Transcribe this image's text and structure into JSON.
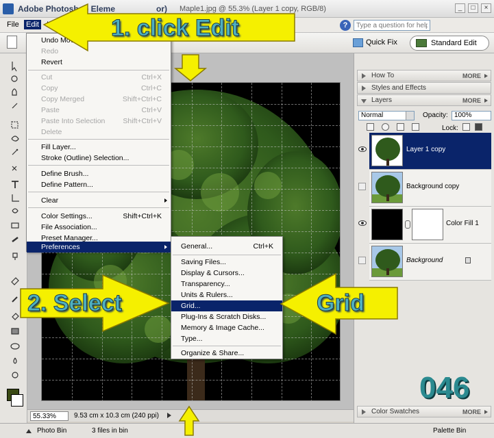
{
  "window": {
    "title": "Adobe Photoshop Eleme",
    "title_tail": "or)",
    "document": "Maple1.jpg @ 55.3% (Layer 1 copy, RGB/8)"
  },
  "menubar": {
    "file": "File",
    "edit": "Edit",
    "image_partial": "Im",
    "help_placeholder": "Type a question for help"
  },
  "options": {
    "quick_fix": "Quick Fix",
    "standard_edit": "Standard Edit"
  },
  "edit_menu": {
    "items": [
      {
        "label": "Undo Move",
        "shortcut": "",
        "disabled": false
      },
      {
        "label": "Redo",
        "shortcut": "",
        "disabled": true
      },
      {
        "label": "Revert",
        "shortcut": "",
        "disabled": false
      },
      {
        "label": "Cut",
        "shortcut": "Ctrl+X",
        "disabled": true
      },
      {
        "label": "Copy",
        "shortcut": "Ctrl+C",
        "disabled": true
      },
      {
        "label": "Copy Merged",
        "shortcut": "Shift+Ctrl+C",
        "disabled": true
      },
      {
        "label": "Paste",
        "shortcut": "Ctrl+V",
        "disabled": true
      },
      {
        "label": "Paste Into Selection",
        "shortcut": "Shift+Ctrl+V",
        "disabled": true
      },
      {
        "label": "Delete",
        "shortcut": "",
        "disabled": true
      },
      {
        "label": "Fill Layer...",
        "shortcut": "",
        "disabled": false
      },
      {
        "label": "Stroke (Outline) Selection...",
        "shortcut": "",
        "disabled": false
      },
      {
        "label": "Define Brush...",
        "shortcut": "",
        "disabled": false
      },
      {
        "label": "Define Pattern...",
        "shortcut": "",
        "disabled": false
      },
      {
        "label": "Clear",
        "shortcut": "",
        "disabled": false
      },
      {
        "label": "Color Settings...",
        "shortcut": "Shift+Ctrl+K",
        "disabled": false
      },
      {
        "label": "File Association...",
        "shortcut": "",
        "disabled": false
      },
      {
        "label": "Preset Manager...",
        "shortcut": "",
        "disabled": false
      },
      {
        "label": "Preferences",
        "shortcut": "",
        "disabled": false
      }
    ]
  },
  "prefs_menu": {
    "items": [
      {
        "label": "General...",
        "shortcut": "Ctrl+K"
      },
      {
        "label": "Saving Files...",
        "shortcut": ""
      },
      {
        "label": "Display & Cursors...",
        "shortcut": ""
      },
      {
        "label": "Transparency...",
        "shortcut": ""
      },
      {
        "label": "Units & Rulers...",
        "shortcut": ""
      },
      {
        "label": "Grid...",
        "shortcut": ""
      },
      {
        "label": "Plug-Ins & Scratch Disks...",
        "shortcut": ""
      },
      {
        "label": "Memory & Image Cache...",
        "shortcut": ""
      },
      {
        "label": "Type...",
        "shortcut": ""
      },
      {
        "label": "Organize & Share...",
        "shortcut": ""
      }
    ]
  },
  "palettes": {
    "how_to": "How To",
    "styles": "Styles and Effects",
    "layers": "Layers",
    "color_swatches": "Color Swatches",
    "more": "MORE",
    "blend_mode": "Normal",
    "opacity_label": "Opacity:",
    "opacity_value": "100%",
    "lock_label": "Lock:"
  },
  "layers": [
    {
      "name": "Layer 1 copy",
      "visible": true,
      "selected": true
    },
    {
      "name": "Background copy",
      "visible": false,
      "selected": false
    },
    {
      "name": "Color Fill 1",
      "visible": true,
      "selected": false
    },
    {
      "name": "Background",
      "visible": false,
      "selected": false
    }
  ],
  "status": {
    "zoom": "55.33%",
    "dims": "9.53 cm x 10.3 cm (240 ppi)"
  },
  "bottom": {
    "photo_bin": "Photo Bin",
    "files_in_bin": "3 files in bin",
    "palette_bin": "Palette Bin"
  },
  "annotations": {
    "step1": "1. click Edit",
    "step2": "2. Select",
    "grid": "Grid",
    "number": "046"
  },
  "colors": {
    "highlight": "#0a246a",
    "callout_arrow": "#f5f000",
    "callout_text": "#4fb0c0",
    "foreground_swatch": "#3a4a14"
  }
}
